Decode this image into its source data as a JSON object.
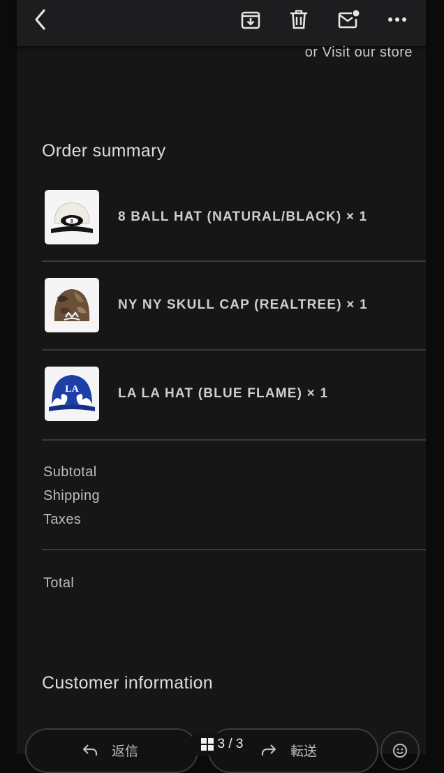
{
  "toolbar": {
    "back_icon": "chevron-left-icon",
    "archive_icon": "archive-icon",
    "delete_icon": "trash-icon",
    "mark_unread_icon": "mail-unread-icon",
    "more_icon": "more-horizontal-icon"
  },
  "email": {
    "visit_store": "or  Visit our store",
    "order_summary_title": "Order summary",
    "items": [
      {
        "label": "8 BALL HAT (NATURAL/BLACK) × 1",
        "thumb": "white-cap-8-ball"
      },
      {
        "label": "NY NY SKULL CAP (REALTREE) × 1",
        "thumb": "camo-beanie"
      },
      {
        "label": "LA LA HAT (BLUE FLAME) × 1",
        "thumb": "blue-flame-cap"
      }
    ],
    "summary": {
      "subtotal_label": "Subtotal",
      "shipping_label": "Shipping",
      "taxes_label": "Taxes",
      "total_label": "Total"
    },
    "customer_info_title": "Customer information"
  },
  "bottom": {
    "reply_label": "返信",
    "forward_label": "転送",
    "page_counter": "3 / 3"
  },
  "colors": {
    "background": "#161617",
    "toolbar": "#1d1d1f",
    "text": "#d9d9d9",
    "divider": "#3a3a3c"
  }
}
